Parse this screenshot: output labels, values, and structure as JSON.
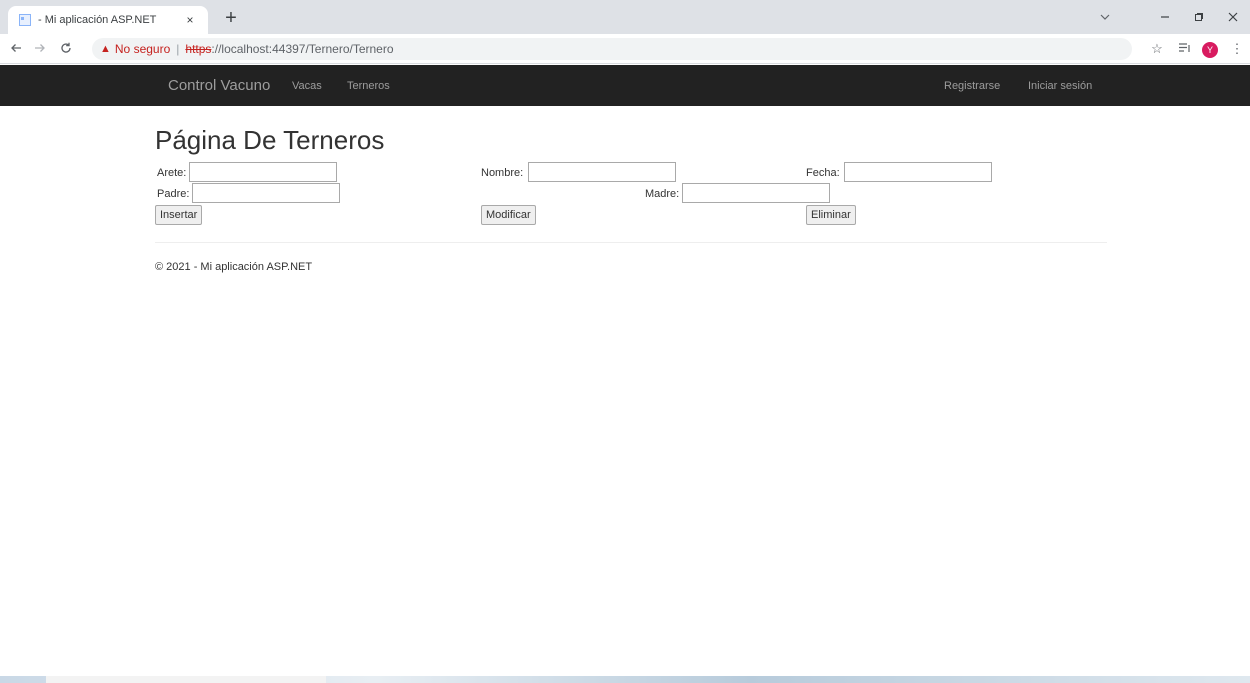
{
  "browser": {
    "tab_title": "- Mi aplicación ASP.NET",
    "tab_close": "×",
    "new_tab": "+",
    "url": {
      "warning": "No seguro",
      "separator": "|",
      "scheme": "https",
      "rest": "://localhost:44397/Ternero/Ternero"
    },
    "avatar_letter": "Y"
  },
  "navbar": {
    "brand": "Control Vacuno",
    "links": [
      "Vacas",
      "Terneros"
    ],
    "right_links": [
      "Registrarse",
      "Iniciar sesión"
    ]
  },
  "page": {
    "title": "Página De Terneros",
    "fields": {
      "arete": {
        "label": "Arete:",
        "value": ""
      },
      "nombre": {
        "label": "Nombre:",
        "value": ""
      },
      "fecha": {
        "label": "Fecha:",
        "value": ""
      },
      "padre": {
        "label": "Padre:",
        "value": ""
      },
      "madre": {
        "label": "Madre:",
        "value": ""
      }
    },
    "buttons": {
      "insertar": "Insertar",
      "modificar": "Modificar",
      "eliminar": "Eliminar"
    }
  },
  "footer": {
    "text": "© 2021 - Mi aplicación ASP.NET"
  },
  "colors": {
    "navbar_bg": "#222222",
    "navbar_text": "#9d9d9d",
    "warning": "#c5221f"
  }
}
